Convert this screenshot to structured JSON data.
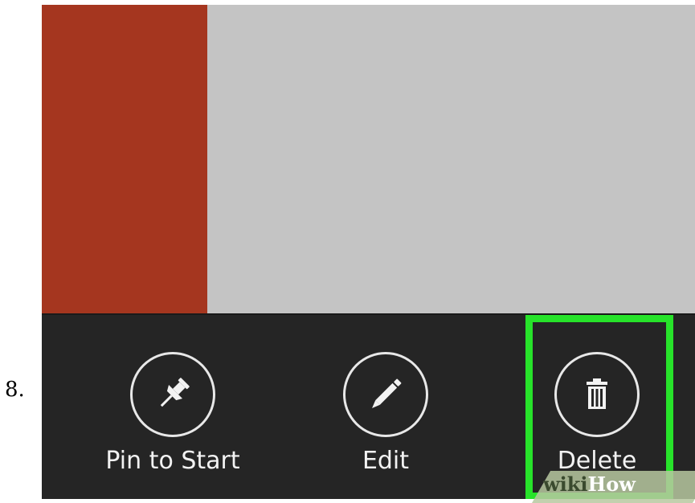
{
  "step": {
    "number": "8."
  },
  "tiles": {
    "left_color": "#a5361f",
    "right_color": "#c4c4c4"
  },
  "app_bar": {
    "background": "#252525",
    "buttons": [
      {
        "label": "Pin to Start",
        "icon": "pin-icon"
      },
      {
        "label": "Edit",
        "icon": "pencil-icon"
      },
      {
        "label": "Delete",
        "icon": "trash-icon"
      }
    ]
  },
  "highlight": {
    "target": "Delete",
    "color": "#27e32a"
  },
  "watermark": {
    "prefix": "wiki",
    "suffix": "How"
  }
}
